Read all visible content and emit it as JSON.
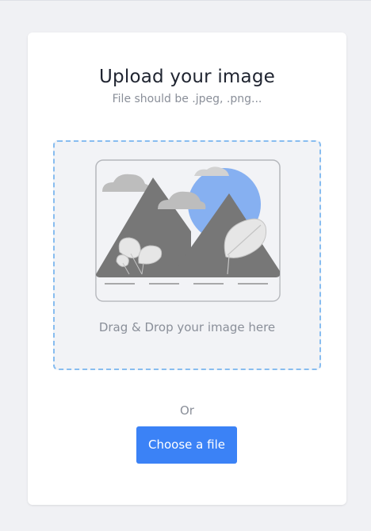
{
  "card": {
    "title": "Upload your image",
    "subtitle": "File should be .jpeg, .png..."
  },
  "dropzone": {
    "label": "Drag & Drop your image here",
    "illustration_icon": "image-placeholder-icon"
  },
  "divider_text": "Or",
  "actions": {
    "choose_file_label": "Choose a file"
  },
  "colors": {
    "page_background": "#f0f1f4",
    "card_background": "#ffffff",
    "dropzone_background": "#f2f3f6",
    "dropzone_border": "#88bdf0",
    "primary_button": "#3b82f6",
    "title_text": "#1f2430",
    "muted_text": "#8a8f99"
  }
}
